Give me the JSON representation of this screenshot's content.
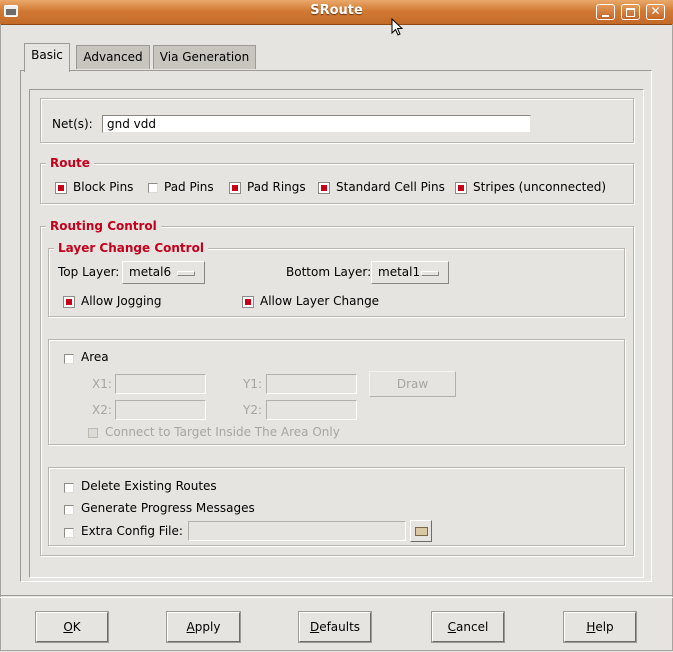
{
  "window": {
    "title": "SRoute"
  },
  "tabs": [
    {
      "label": "Basic",
      "active": true
    },
    {
      "label": "Advanced",
      "active": false
    },
    {
      "label": "Via Generation",
      "active": false
    }
  ],
  "nets": {
    "label": "Net(s):",
    "value": "gnd vdd"
  },
  "route": {
    "title": "Route",
    "options": [
      {
        "label": "Block Pins",
        "checked": true
      },
      {
        "label": "Pad Pins",
        "checked": false
      },
      {
        "label": "Pad Rings",
        "checked": true
      },
      {
        "label": "Standard Cell Pins",
        "checked": true
      },
      {
        "label": "Stripes (unconnected)",
        "checked": true
      }
    ]
  },
  "routing_control": {
    "title": "Routing Control",
    "layer_change": {
      "title": "Layer Change Control",
      "top_layer_label": "Top Layer:",
      "top_layer_value": "metal6",
      "bottom_layer_label": "Bottom Layer:",
      "bottom_layer_value": "metal1",
      "allow_jogging": {
        "label": "Allow Jogging",
        "checked": true
      },
      "allow_layer_change": {
        "label": "Allow Layer Change",
        "checked": true
      }
    }
  },
  "area": {
    "label": "Area",
    "checked": false,
    "x1_label": "X1:",
    "y1_label": "Y1:",
    "x2_label": "X2:",
    "y2_label": "Y2:",
    "x1_value": "",
    "y1_value": "",
    "x2_value": "",
    "y2_value": "",
    "draw_label": "Draw",
    "connect_label": "Connect to Target Inside The Area Only"
  },
  "misc": {
    "delete_existing": "Delete Existing Routes",
    "generate_progress": "Generate Progress Messages",
    "extra_config": "Extra Config File:",
    "extra_config_value": ""
  },
  "buttons": {
    "ok": {
      "mn": "O",
      "rest": "K"
    },
    "apply": {
      "mn": "A",
      "rest": "pply"
    },
    "defaults": {
      "mn": "D",
      "rest": "efaults"
    },
    "cancel": {
      "mn": "C",
      "rest": "ancel"
    },
    "help": {
      "mn": "H",
      "rest": "elp"
    }
  },
  "colors": {
    "accent": "#c4001c",
    "titlebar": "#d27a34",
    "background": "#e6e4e0"
  }
}
